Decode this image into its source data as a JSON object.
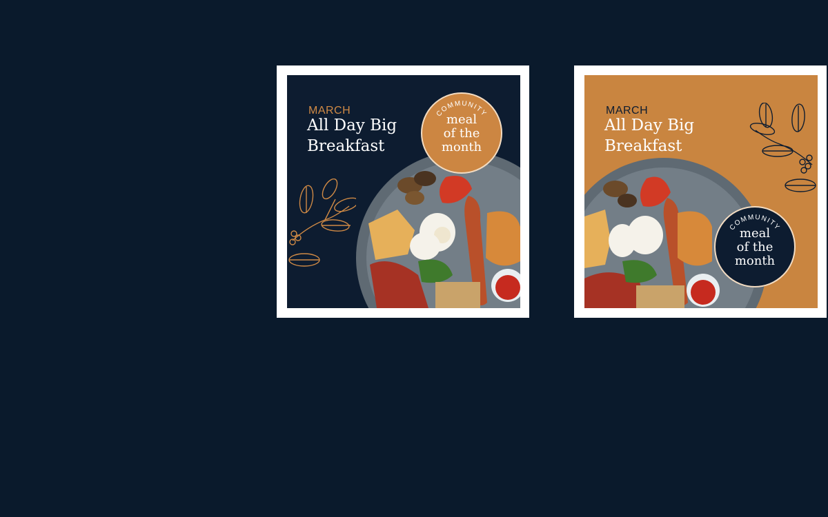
{
  "cards": [
    {
      "month": "MARCH",
      "title_line1": "All Day Big",
      "title_line2": "Breakfast",
      "badge_top": "COMMUNITY",
      "badge_line1": "meal",
      "badge_line2": "of the",
      "badge_line3": "month",
      "background": "#0d1c30",
      "accent": "#cc8642",
      "sprig_icon": "leaf-sprig-icon"
    },
    {
      "month": "MARCH",
      "title_line1": "All Day Big",
      "title_line2": "Breakfast",
      "badge_top": "COMMUNITY",
      "badge_line1": "meal",
      "badge_line2": "of the",
      "badge_line3": "month",
      "background": "#c98540",
      "accent": "#0d1c30",
      "sprig_icon": "leaf-sprig-icon"
    }
  ]
}
